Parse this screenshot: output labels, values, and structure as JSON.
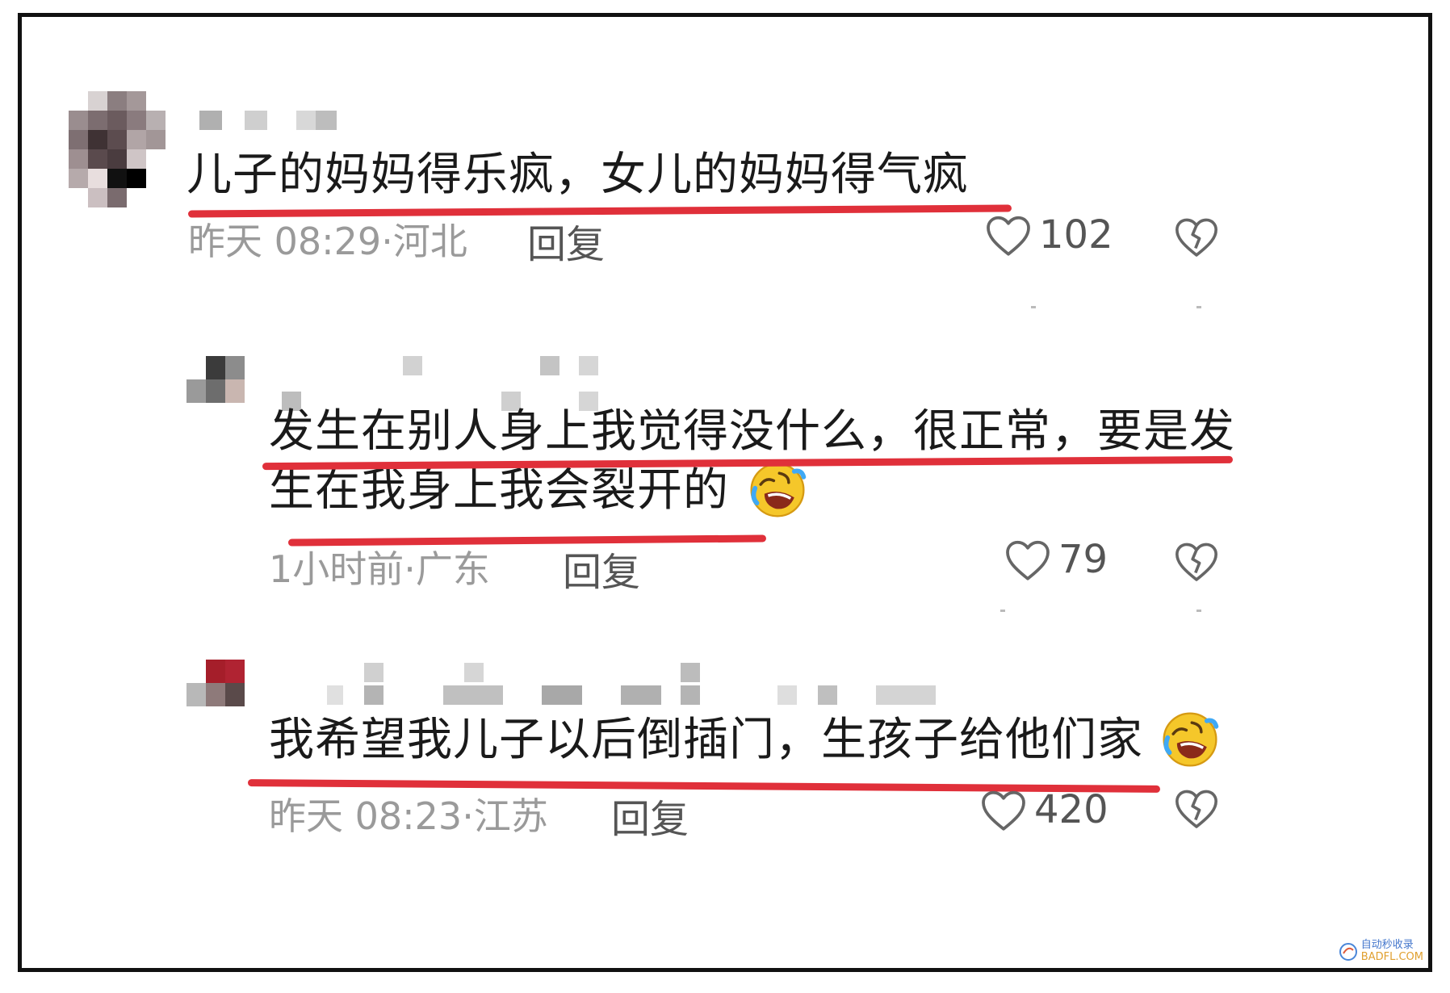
{
  "comments": [
    {
      "text": "儿子的妈妈得乐疯，女儿的妈妈得气疯",
      "time": "昨天 08:29",
      "location": "河北",
      "reply_label": "回复",
      "likes": "102"
    },
    {
      "text_line1": "发生在别人身上我觉得没什么，很正常，要是发",
      "text_line2": "生在我身上我会裂开的",
      "time": "1小时前",
      "location": "广东",
      "reply_label": "回复",
      "likes": "79"
    },
    {
      "text": "我希望我儿子以后倒插门，生孩子给他们家",
      "time": "昨天 08:23",
      "location": "江苏",
      "reply_label": "回复",
      "likes": "420"
    }
  ],
  "separator": "·",
  "watermark": {
    "line1": "自动秒收录",
    "line2": "BADFL.COM"
  },
  "colors": {
    "underline": "#e0303a",
    "text": "#1a1a1a",
    "meta": "#9a9a9a"
  },
  "icons": {
    "like": "heart-outline-icon",
    "dislike": "broken-heart-icon",
    "emoji": "rolling-laughing-emoji"
  }
}
